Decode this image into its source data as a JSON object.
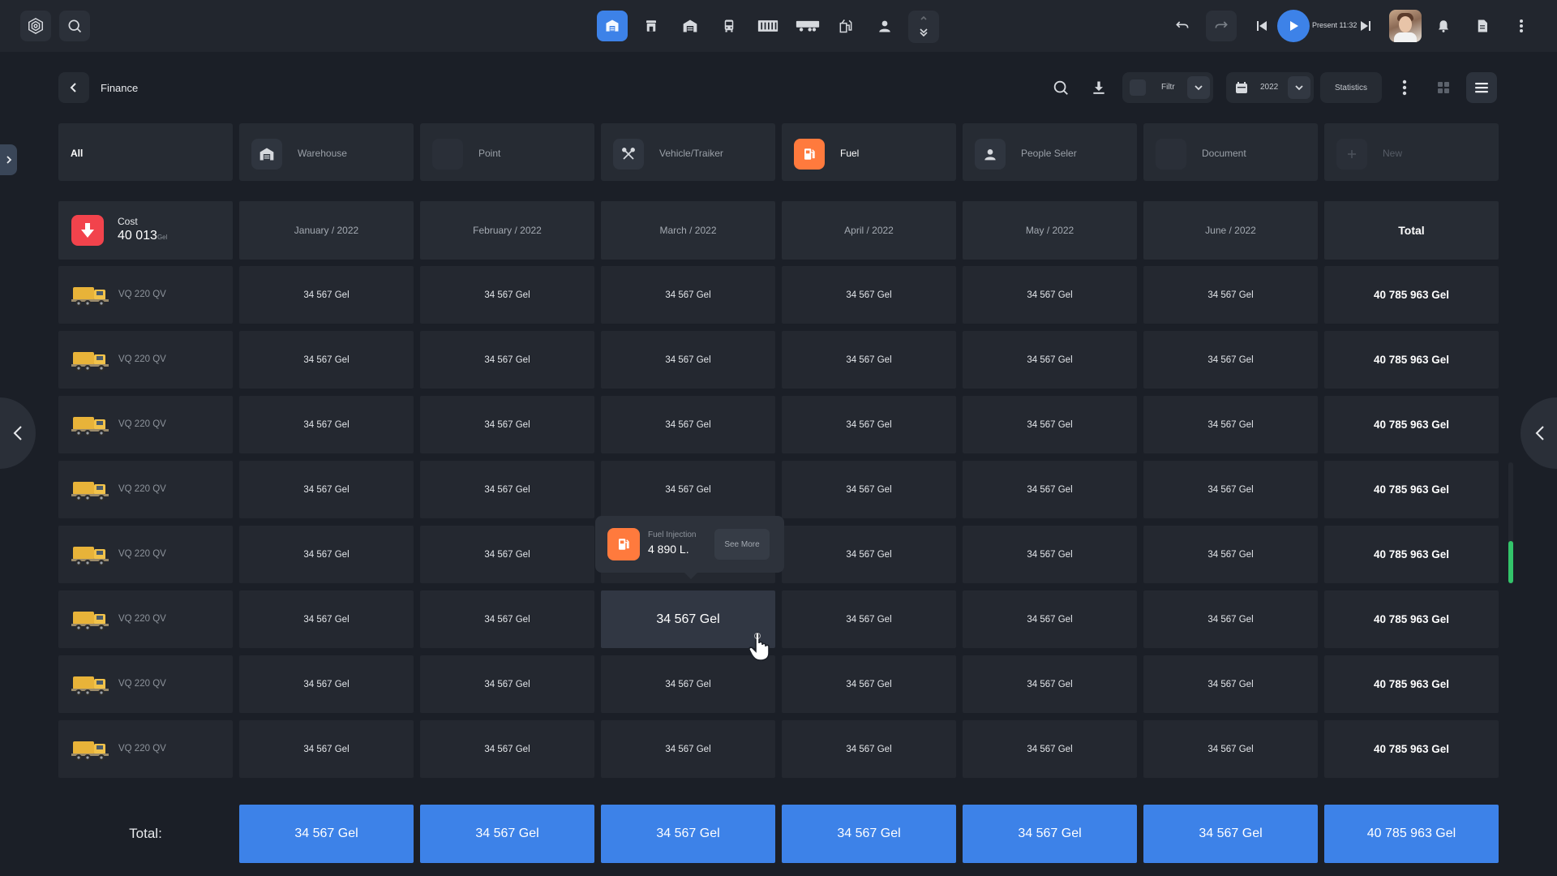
{
  "header": {
    "title": "Finance",
    "filter_label": "Filtr",
    "year_label": "2022",
    "statistics_label": "Statistics"
  },
  "player": {
    "present_label": "Present 11:32"
  },
  "categories": [
    {
      "label": "All",
      "icon": "none"
    },
    {
      "label": "Warehouse",
      "icon": "warehouse-icon"
    },
    {
      "label": "Point",
      "icon": "none"
    },
    {
      "label": "Vehicle/Traiker",
      "icon": "tools-icon"
    },
    {
      "label": "Fuel",
      "icon": "fuel-icon",
      "active": true
    },
    {
      "label": "People Seler",
      "icon": "person-icon"
    },
    {
      "label": "Document",
      "icon": "none"
    },
    {
      "label": "New",
      "icon": "plus-icon"
    }
  ],
  "table": {
    "cost_label": "Cost",
    "cost_value": "40 013",
    "cost_unit": "Gel",
    "months": [
      "January / 2022",
      "February / 2022",
      "March / 2022",
      "April / 2022",
      "May / 2022",
      "June / 2022"
    ],
    "total_header": "Total",
    "rows": [
      {
        "label": "VQ 220 QV",
        "values": [
          "34 567 Gel",
          "34 567 Gel",
          "34 567 Gel",
          "34 567 Gel",
          "34 567 Gel",
          "34 567 Gel"
        ],
        "total": "40 785 963 Gel"
      },
      {
        "label": "VQ 220 QV",
        "values": [
          "34 567 Gel",
          "34 567 Gel",
          "34 567 Gel",
          "34 567 Gel",
          "34 567 Gel",
          "34 567 Gel"
        ],
        "total": "40 785 963 Gel"
      },
      {
        "label": "VQ 220 QV",
        "values": [
          "34 567 Gel",
          "34 567 Gel",
          "34 567 Gel",
          "34 567 Gel",
          "34 567 Gel",
          "34 567 Gel"
        ],
        "total": "40 785 963 Gel"
      },
      {
        "label": "VQ 220 QV",
        "values": [
          "34 567 Gel",
          "34 567 Gel",
          "34 567 Gel",
          "34 567 Gel",
          "34 567 Gel",
          "34 567 Gel"
        ],
        "total": "40 785 963 Gel"
      },
      {
        "label": "VQ 220 QV",
        "values": [
          "34 567 Gel",
          "34 567 Gel",
          "",
          "34 567 Gel",
          "34 567 Gel",
          "34 567 Gel"
        ],
        "total": "40 785 963 Gel"
      },
      {
        "label": "VQ 220 QV",
        "values": [
          "34 567 Gel",
          "34 567 Gel",
          "34 567 Gel",
          "34 567 Gel",
          "34 567 Gel",
          "34 567 Gel"
        ],
        "total": "40 785 963 Gel"
      },
      {
        "label": "VQ 220 QV",
        "values": [
          "34 567 Gel",
          "34 567 Gel",
          "34 567 Gel",
          "34 567 Gel",
          "34 567 Gel",
          "34 567 Gel"
        ],
        "total": "40 785 963 Gel"
      },
      {
        "label": "VQ 220 QV",
        "values": [
          "34 567 Gel",
          "34 567 Gel",
          "34 567 Gel",
          "34 567 Gel",
          "34 567 Gel",
          "34 567 Gel"
        ],
        "total": "40 785 963 Gel"
      }
    ],
    "footer_label": "Total:",
    "footer_values": [
      "34 567 Gel",
      "34 567 Gel",
      "34 567 Gel",
      "34 567 Gel",
      "34 567 Gel",
      "34 567 Gel"
    ],
    "footer_total": "40 785 963 Gel"
  },
  "tooltip": {
    "label": "Fuel Injection",
    "value": "4 890 L.",
    "button": "See More"
  },
  "colors": {
    "accent": "#3d82e8",
    "fuel": "#ff7a3d",
    "cost": "#f2434c",
    "scroll": "#33c46a"
  }
}
